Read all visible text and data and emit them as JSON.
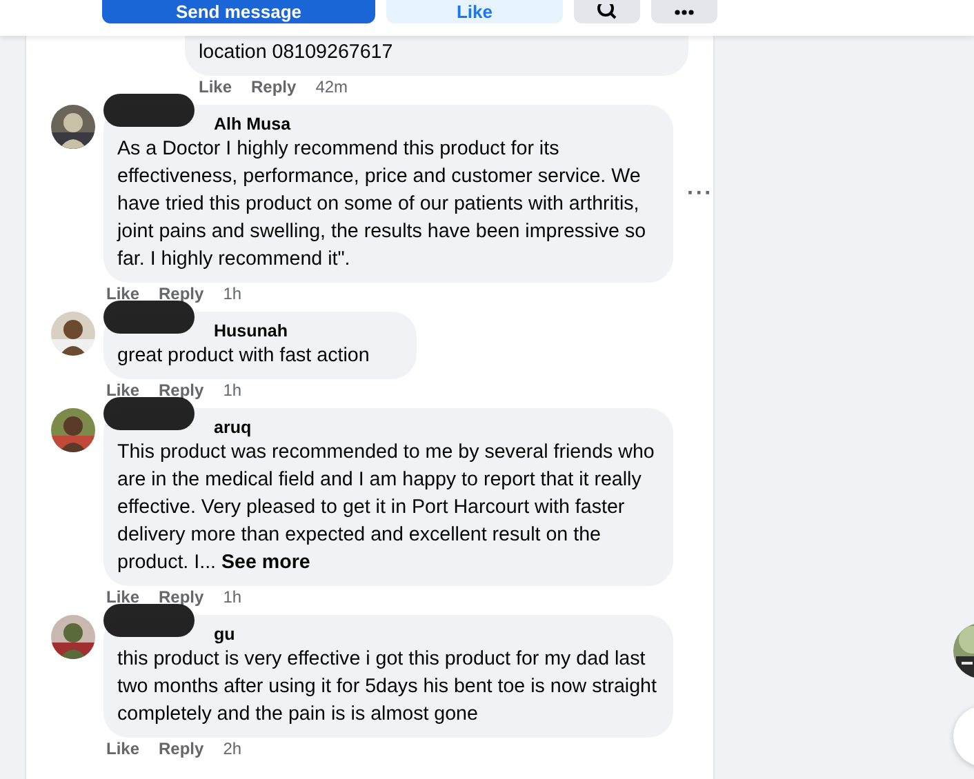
{
  "header": {
    "buttons": [
      {
        "label": "Send message",
        "kind": "primary"
      },
      {
        "label": "Like",
        "kind": "secondary"
      },
      {
        "kind": "search"
      },
      {
        "kind": "more"
      }
    ]
  },
  "reply": {
    "text": "location 08109267617",
    "actions": [
      "Like",
      "Reply",
      "42m"
    ]
  },
  "comments": [
    {
      "name": "Alh Musa",
      "text": "As a Doctor I highly recommend this product for its effectiveness, performance, price and customer service. We have tried this product on some of our patients with arthritis, joint pains and swelling, the results have been impressive so far. I highly recommend it\".",
      "actions": [
        "Like",
        "Reply",
        "1h"
      ],
      "menu": "···"
    },
    {
      "name": "Husunah",
      "text": "great product with fast action",
      "actions": [
        "Like",
        "Reply",
        "1h"
      ]
    },
    {
      "name": "aruq",
      "text": "This product was recommended to me by several friends who are in the medical field and I am happy to report that it really effective. Very pleased to get it in Port Harcourt with faster delivery more than expected and excellent result on the product. I...",
      "more": "See more",
      "actions": [
        "Like",
        "Reply",
        "1h"
      ]
    },
    {
      "name": "gu",
      "text": "this product is very effective i got this product for my dad last two months after using it for 5days his bent toe is now straight completely and the pain is is almost gone",
      "actions": [
        "Like",
        "Reply",
        "2h"
      ]
    }
  ]
}
